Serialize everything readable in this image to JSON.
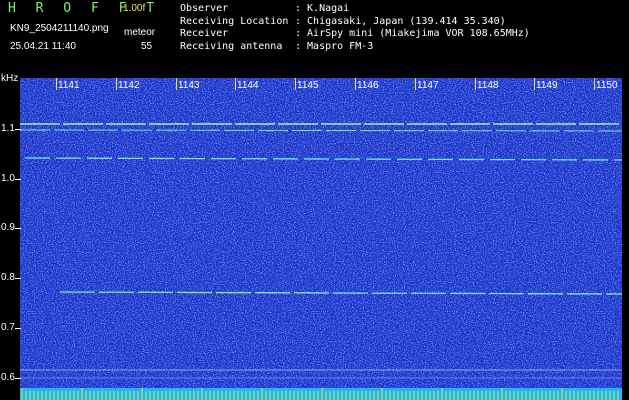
{
  "app": {
    "name": "H R O F F T",
    "version": "1.00f",
    "filename": "KN9_2504211140.png",
    "mode": "meteor",
    "datetime": "25.04.21 11:40",
    "count": "55"
  },
  "info": {
    "rows": [
      {
        "label": "Observer",
        "value": ": K.Nagai"
      },
      {
        "label": "Receiving Location",
        "value": ": Chigasaki, Japan (139.414 35.340)"
      },
      {
        "label": "Receiver",
        "value": ": AirSpy mini (Miakejima VOR 108.65MHz)"
      },
      {
        "label": "Receiving antenna",
        "value": ": Maspro FM-3"
      }
    ]
  },
  "axis": {
    "unit": "kHz",
    "y_ticks": [
      "1.1",
      "1.0",
      "0.9",
      "0.8",
      "0.7",
      "0.6"
    ],
    "x_ticks": [
      "1141",
      "1142",
      "1143",
      "1144",
      "1145",
      "1146",
      "1147",
      "1148",
      "1149",
      "1150"
    ]
  },
  "colors": {
    "background": "#000000",
    "spectrogram": "#1a30c8",
    "signal": "#7cf0a0",
    "bottom_bar": "#1ab7ff",
    "tick_marks": "#e8e820"
  }
}
